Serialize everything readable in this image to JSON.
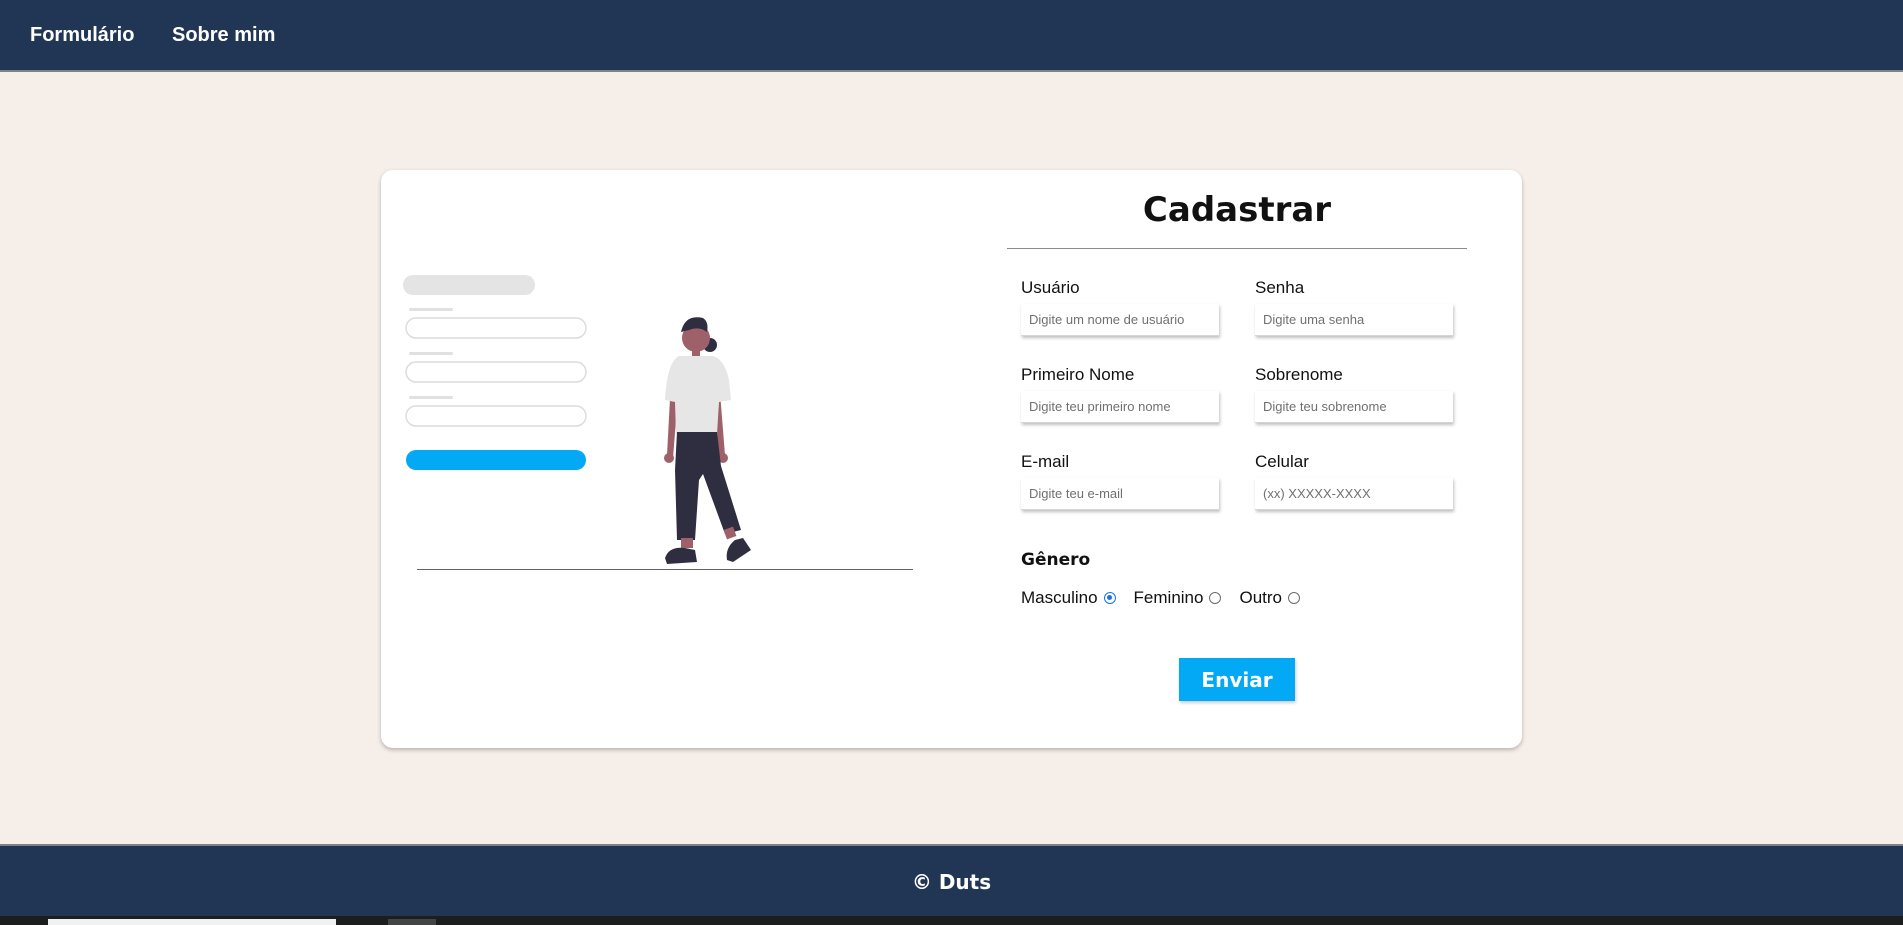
{
  "nav": {
    "items": [
      {
        "label": "Formulário"
      },
      {
        "label": "Sobre mim"
      }
    ]
  },
  "form": {
    "title": "Cadastrar",
    "fields": {
      "usuario": {
        "label": "Usuário",
        "placeholder": "Digite um nome de usuário"
      },
      "senha": {
        "label": "Senha",
        "placeholder": "Digite uma senha"
      },
      "primeiro_nome": {
        "label": "Primeiro Nome",
        "placeholder": "Digite teu primeiro nome"
      },
      "sobrenome": {
        "label": "Sobrenome",
        "placeholder": "Digite teu sobrenome"
      },
      "email": {
        "label": "E-mail",
        "placeholder": "Digite teu e-mail"
      },
      "celular": {
        "label": "Celular",
        "placeholder": "(xx) XXXXX-XXXX"
      }
    },
    "gender": {
      "title": "Gênero",
      "options": [
        {
          "label": "Masculino",
          "checked": true
        },
        {
          "label": "Feminino",
          "checked": false
        },
        {
          "label": "Outro",
          "checked": false
        }
      ]
    },
    "submit_label": "Enviar"
  },
  "footer": {
    "text": "© Duts"
  },
  "colors": {
    "navbar": "#213654",
    "background": "#f6eee8",
    "accent": "#03a9f4",
    "radio_checked": "#1a73e8"
  }
}
